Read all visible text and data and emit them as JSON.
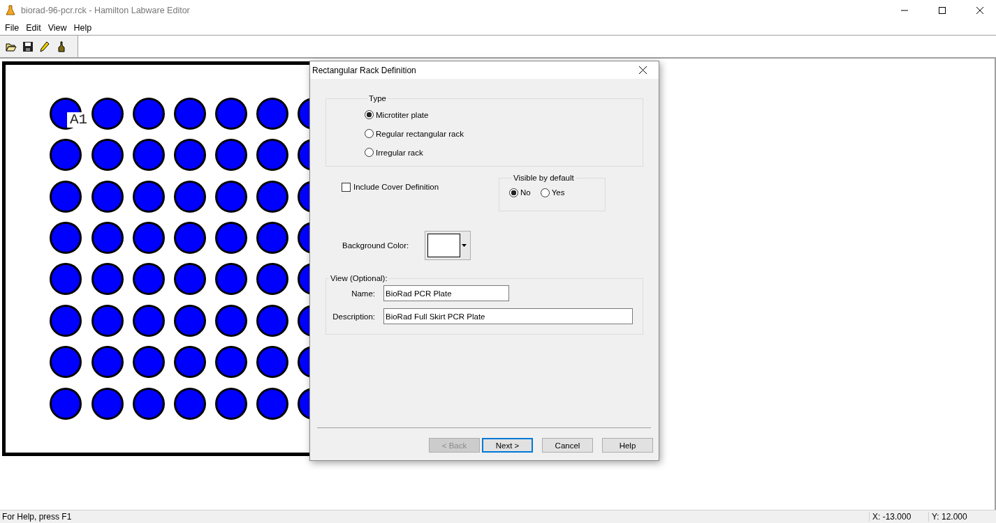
{
  "window": {
    "title": "biorad-96-pcr.rck  - Hamilton Labware Editor"
  },
  "menu": [
    "File",
    "Edit",
    "View",
    "Help"
  ],
  "plate": {
    "well_label": "A1"
  },
  "dialog": {
    "title": "Rectangular Rack Definition",
    "type_group": {
      "legend": "Type",
      "options": [
        {
          "label": "Microtiter plate",
          "selected": true
        },
        {
          "label": "Regular rectangular rack",
          "selected": false
        },
        {
          "label": "Irregular rack",
          "selected": false
        }
      ]
    },
    "cover": {
      "label": "Include Cover Definition",
      "checked": false
    },
    "visible_group": {
      "legend": "Visible by default",
      "options": [
        {
          "label": "No",
          "selected": true
        },
        {
          "label": "Yes",
          "selected": false
        }
      ]
    },
    "background": {
      "label": "Background Color:"
    },
    "view_group": {
      "legend": "View (Optional):",
      "fields": [
        {
          "label": "Name:",
          "value": "BioRad PCR Plate"
        },
        {
          "label": "Description:",
          "value": "BioRad Full Skirt PCR Plate"
        }
      ]
    },
    "buttons": [
      {
        "label": "< Back",
        "disabled": true,
        "default": false
      },
      {
        "label": "Next >",
        "disabled": false,
        "default": true
      },
      {
        "label": "Cancel",
        "disabled": false,
        "default": false
      },
      {
        "label": "Help",
        "disabled": false,
        "default": false
      }
    ]
  },
  "status_bar": {
    "help": "For Help, press F1",
    "x": "X: -13.000",
    "y": "Y: 12.000"
  }
}
